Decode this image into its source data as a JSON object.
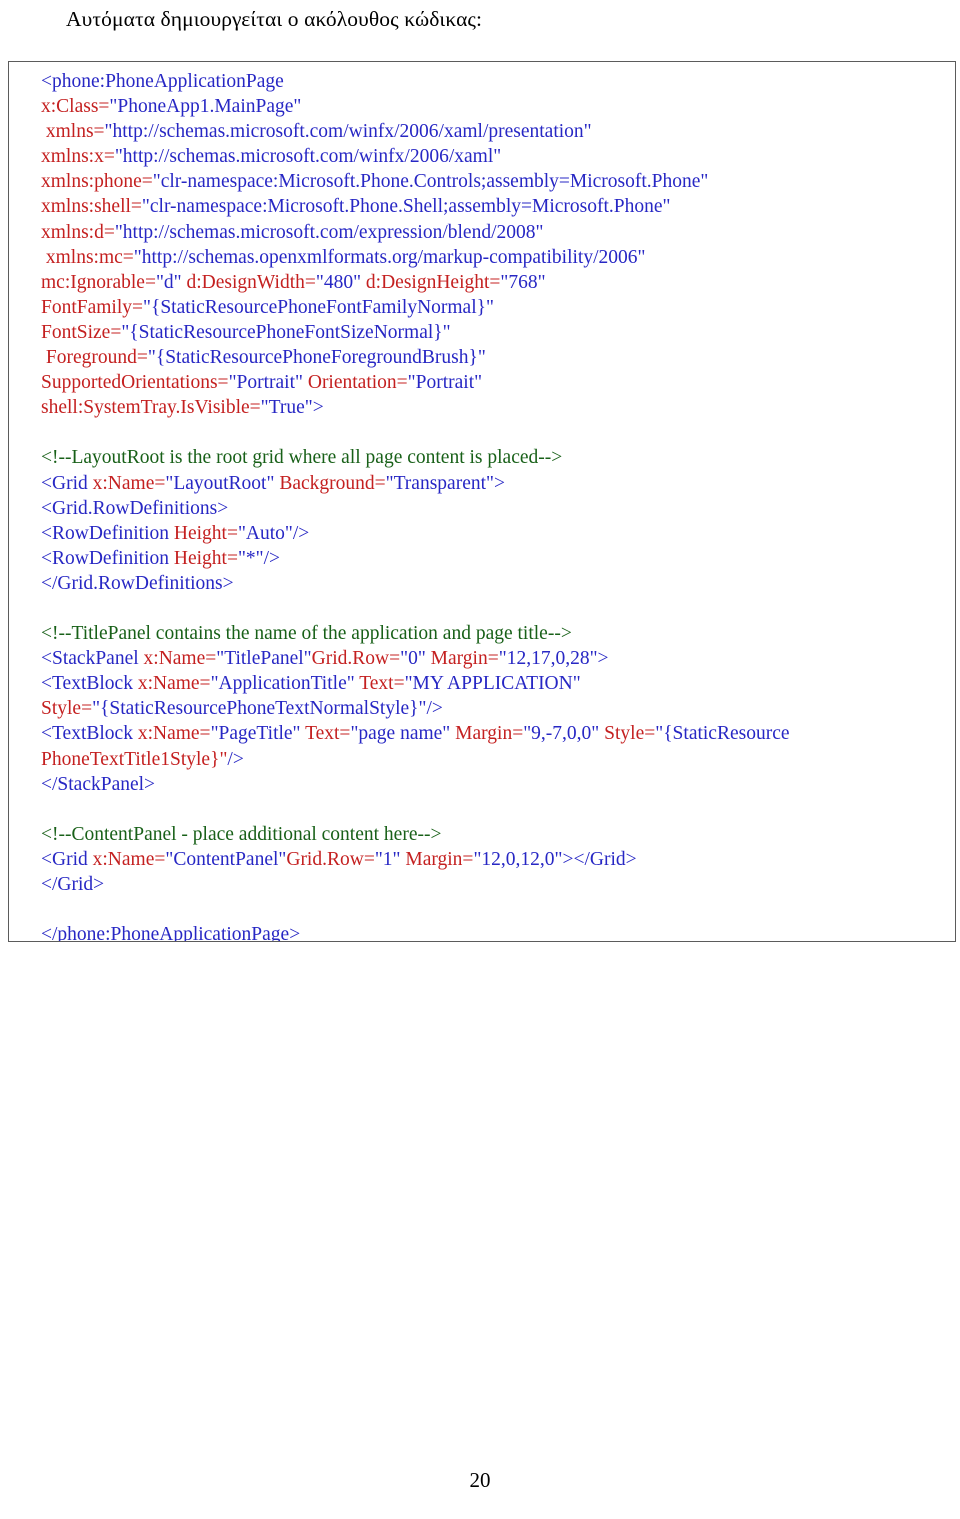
{
  "heading": "Αυτόματα δημιουργείται ο ακόλουθος κώδικας:",
  "page_number": "20",
  "colors": {
    "tag": "#2727c4",
    "attribute": "#c42020",
    "value": "#2727c4",
    "comment": "#186018",
    "box_border": "#5b5b5b",
    "background": "#ffffff",
    "heading_text": "#000000"
  },
  "code": {
    "language": "XAML",
    "lines": [
      {
        "indent": 0,
        "segments": [
          {
            "t": "tag",
            "s": "<phone:PhoneApplicationPage"
          }
        ]
      },
      {
        "indent": 0,
        "segments": [
          {
            "t": "attr",
            "s": "x:Class="
          },
          {
            "t": "val",
            "s": "\"PhoneApp1.MainPage\""
          }
        ]
      },
      {
        "indent": 1,
        "segments": [
          {
            "t": "attr",
            "s": "xmlns="
          },
          {
            "t": "val",
            "s": "\"http://schemas.microsoft.com/winfx/2006/xaml/presentation\""
          }
        ]
      },
      {
        "indent": 0,
        "segments": [
          {
            "t": "attr",
            "s": "xmlns:x="
          },
          {
            "t": "val",
            "s": "\"http://schemas.microsoft.com/winfx/2006/xaml\""
          }
        ]
      },
      {
        "indent": 0,
        "segments": [
          {
            "t": "attr",
            "s": "xmlns:phone="
          },
          {
            "t": "val",
            "s": "\"clr-namespace:Microsoft.Phone.Controls;assembly=Microsoft.Phone\""
          }
        ]
      },
      {
        "indent": 0,
        "segments": [
          {
            "t": "attr",
            "s": "xmlns:shell="
          },
          {
            "t": "val",
            "s": "\"clr-namespace:Microsoft.Phone.Shell;assembly=Microsoft.Phone\""
          }
        ]
      },
      {
        "indent": 0,
        "segments": [
          {
            "t": "attr",
            "s": "xmlns:d="
          },
          {
            "t": "val",
            "s": "\"http://schemas.microsoft.com/expression/blend/2008\""
          }
        ]
      },
      {
        "indent": 1,
        "segments": [
          {
            "t": "attr",
            "s": "xmlns:mc="
          },
          {
            "t": "val",
            "s": "\"http://schemas.openxmlformats.org/markup-compatibility/2006\""
          }
        ]
      },
      {
        "indent": 0,
        "segments": [
          {
            "t": "attr",
            "s": "mc:Ignorable="
          },
          {
            "t": "val",
            "s": "\"d\""
          },
          {
            "t": "plain",
            "s": " "
          },
          {
            "t": "attr",
            "s": "d:DesignWidth="
          },
          {
            "t": "val",
            "s": "\"480\""
          },
          {
            "t": "plain",
            "s": " "
          },
          {
            "t": "attr",
            "s": "d:DesignHeight="
          },
          {
            "t": "val",
            "s": "\"768\""
          }
        ]
      },
      {
        "indent": 0,
        "segments": [
          {
            "t": "attr",
            "s": "FontFamily="
          },
          {
            "t": "val",
            "s": "\"{StaticResourcePhoneFontFamilyNormal}\""
          }
        ]
      },
      {
        "indent": 0,
        "segments": [
          {
            "t": "attr",
            "s": "FontSize="
          },
          {
            "t": "val",
            "s": "\"{StaticResourcePhoneFontSizeNormal}\""
          }
        ]
      },
      {
        "indent": 1,
        "segments": [
          {
            "t": "attr",
            "s": "Foreground="
          },
          {
            "t": "val",
            "s": "\"{StaticResourcePhoneForegroundBrush}\""
          }
        ]
      },
      {
        "indent": 0,
        "segments": [
          {
            "t": "attr",
            "s": "SupportedOrientations="
          },
          {
            "t": "val",
            "s": "\"Portrait\""
          },
          {
            "t": "plain",
            "s": " "
          },
          {
            "t": "attr",
            "s": "Orientation="
          },
          {
            "t": "val",
            "s": "\"Portrait\""
          }
        ]
      },
      {
        "indent": 0,
        "segments": [
          {
            "t": "attr",
            "s": "shell:SystemTray.IsVisible="
          },
          {
            "t": "val",
            "s": "\"True\""
          },
          {
            "t": "tag",
            "s": ">"
          }
        ]
      },
      {
        "indent": 0,
        "segments": []
      },
      {
        "indent": 0,
        "segments": [
          {
            "t": "cmt",
            "s": "<!--LayoutRoot is the root grid where all page content is placed-->"
          }
        ]
      },
      {
        "indent": 0,
        "segments": [
          {
            "t": "tag",
            "s": "<Grid "
          },
          {
            "t": "attr",
            "s": "x:Name="
          },
          {
            "t": "val",
            "s": "\"LayoutRoot\""
          },
          {
            "t": "plain",
            "s": " "
          },
          {
            "t": "attr",
            "s": "Background="
          },
          {
            "t": "val",
            "s": "\"Transparent\""
          },
          {
            "t": "tag",
            "s": ">"
          }
        ]
      },
      {
        "indent": 0,
        "segments": [
          {
            "t": "tag",
            "s": "<Grid.RowDefinitions>"
          }
        ]
      },
      {
        "indent": 0,
        "segments": [
          {
            "t": "tag",
            "s": "<RowDefinition "
          },
          {
            "t": "attr",
            "s": "Height="
          },
          {
            "t": "val",
            "s": "\"Auto\""
          },
          {
            "t": "tag",
            "s": "/>"
          }
        ]
      },
      {
        "indent": 0,
        "segments": [
          {
            "t": "tag",
            "s": "<RowDefinition "
          },
          {
            "t": "attr",
            "s": "Height="
          },
          {
            "t": "val",
            "s": "\"*\""
          },
          {
            "t": "tag",
            "s": "/>"
          }
        ]
      },
      {
        "indent": 0,
        "segments": [
          {
            "t": "tag",
            "s": "</Grid.RowDefinitions>"
          }
        ]
      },
      {
        "indent": 0,
        "segments": []
      },
      {
        "indent": 0,
        "segments": [
          {
            "t": "cmt",
            "s": "<!--TitlePanel contains the name of the application and page title-->"
          }
        ]
      },
      {
        "indent": 0,
        "segments": [
          {
            "t": "tag",
            "s": "<StackPanel "
          },
          {
            "t": "attr",
            "s": "x:Name="
          },
          {
            "t": "val",
            "s": "\"TitlePanel\""
          },
          {
            "t": "attr",
            "s": "Grid.Row="
          },
          {
            "t": "val",
            "s": "\"0\""
          },
          {
            "t": "plain",
            "s": " "
          },
          {
            "t": "attr",
            "s": "Margin="
          },
          {
            "t": "val",
            "s": "\"12,17,0,28\""
          },
          {
            "t": "tag",
            "s": ">"
          }
        ]
      },
      {
        "indent": 0,
        "segments": [
          {
            "t": "tag",
            "s": "<TextBlock "
          },
          {
            "t": "attr",
            "s": "x:Name="
          },
          {
            "t": "val",
            "s": "\"ApplicationTitle\""
          },
          {
            "t": "plain",
            "s": " "
          },
          {
            "t": "attr",
            "s": "Text="
          },
          {
            "t": "val",
            "s": "\"MY APPLICATION\""
          }
        ]
      },
      {
        "indent": 0,
        "segments": [
          {
            "t": "attr",
            "s": "Style="
          },
          {
            "t": "val",
            "s": "\"{StaticResourcePhoneTextNormalStyle}\""
          },
          {
            "t": "tag",
            "s": "/>"
          }
        ]
      },
      {
        "indent": 0,
        "segments": [
          {
            "t": "tag",
            "s": "<TextBlock "
          },
          {
            "t": "attr",
            "s": "x:Name="
          },
          {
            "t": "val",
            "s": "\"PageTitle\""
          },
          {
            "t": "plain",
            "s": " "
          },
          {
            "t": "attr",
            "s": "Text="
          },
          {
            "t": "val",
            "s": "\"page name\""
          },
          {
            "t": "plain",
            "s": " "
          },
          {
            "t": "attr",
            "s": "Margin="
          },
          {
            "t": "val",
            "s": "\"9,-7,0,0\""
          },
          {
            "t": "plain",
            "s": " "
          },
          {
            "t": "attr",
            "s": "Style="
          },
          {
            "t": "val",
            "s": "\"{StaticResource"
          }
        ]
      },
      {
        "indent": 0,
        "segments": [
          {
            "t": "attr",
            "s": "PhoneTextTitle1Style}\""
          },
          {
            "t": "tag",
            "s": "/>"
          }
        ]
      },
      {
        "indent": 0,
        "segments": [
          {
            "t": "tag",
            "s": "</StackPanel>"
          }
        ]
      },
      {
        "indent": 0,
        "segments": []
      },
      {
        "indent": 0,
        "segments": [
          {
            "t": "cmt",
            "s": "<!--ContentPanel - place additional content here-->"
          }
        ]
      },
      {
        "indent": 0,
        "segments": [
          {
            "t": "tag",
            "s": "<Grid "
          },
          {
            "t": "attr",
            "s": "x:Name="
          },
          {
            "t": "val",
            "s": "\"ContentPanel\""
          },
          {
            "t": "attr",
            "s": "Grid.Row="
          },
          {
            "t": "val",
            "s": "\"1\""
          },
          {
            "t": "plain",
            "s": " "
          },
          {
            "t": "attr",
            "s": "Margin="
          },
          {
            "t": "val",
            "s": "\"12,0,12,0\""
          },
          {
            "t": "tag",
            "s": "></Grid>"
          }
        ]
      },
      {
        "indent": 0,
        "segments": [
          {
            "t": "tag",
            "s": "</Grid>"
          }
        ]
      },
      {
        "indent": 0,
        "segments": []
      },
      {
        "indent": 0,
        "segments": [
          {
            "t": "tag",
            "s": "</phone:PhoneApplicationPage>"
          }
        ]
      }
    ]
  }
}
